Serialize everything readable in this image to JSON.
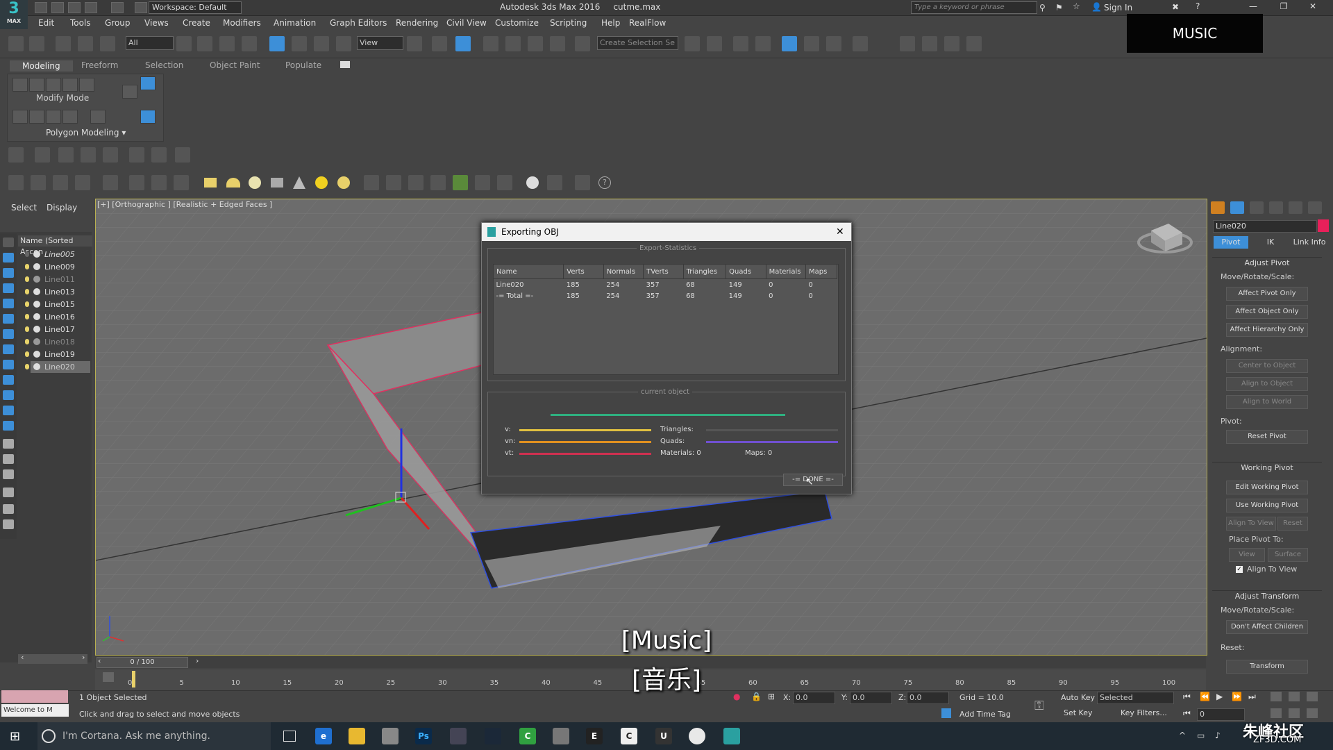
{
  "titlebar": {
    "logo_text": "3",
    "logo_sub": "MAX",
    "workspace": "Workspace: Default",
    "app_title": "Autodesk 3ds Max 2016",
    "file_name": "cutme.max",
    "search_placeholder": "Type a keyword or phrase",
    "signin": "Sign In"
  },
  "menu": [
    "Edit",
    "Tools",
    "Group",
    "Views",
    "Create",
    "Modifiers",
    "Animation",
    "Graph Editors",
    "Rendering",
    "Civil View",
    "Customize",
    "Scripting",
    "Help",
    "RealFlow"
  ],
  "toolbar": {
    "filter_value": "All",
    "refcoord_value": "View",
    "selection_set_placeholder": "Create Selection Se"
  },
  "ribbon": {
    "tabs": [
      "Modeling",
      "Freeform",
      "Selection",
      "Object Paint",
      "Populate"
    ],
    "modify_mode": "Modify Mode",
    "polygon_modeling": "Polygon Modeling"
  },
  "scene_explorer": {
    "tabs": [
      "Select",
      "Display"
    ],
    "header": "Name (Sorted Ascen",
    "items": [
      {
        "name": "Line005",
        "dim": false,
        "italic": true
      },
      {
        "name": "Line009",
        "dim": false,
        "italic": false
      },
      {
        "name": "Line011",
        "dim": true,
        "italic": false
      },
      {
        "name": "Line013",
        "dim": false,
        "italic": false
      },
      {
        "name": "Line015",
        "dim": false,
        "italic": false
      },
      {
        "name": "Line016",
        "dim": false,
        "italic": false
      },
      {
        "name": "Line017",
        "dim": false,
        "italic": false
      },
      {
        "name": "Line018",
        "dim": true,
        "italic": false
      },
      {
        "name": "Line019",
        "dim": false,
        "italic": false
      },
      {
        "name": "Line020",
        "dim": false,
        "italic": false,
        "selected": true
      }
    ]
  },
  "viewport": {
    "label": "[+] [Orthographic ] [Realistic + Edged Faces ]"
  },
  "dialog": {
    "title": "Exporting OBJ",
    "close": "✕",
    "stats_group": "Export-Statistics",
    "columns": [
      "Name",
      "Verts",
      "Normals",
      "TVerts",
      "Triangles",
      "Quads",
      "Materials",
      "Maps"
    ],
    "rows": [
      [
        "Line020",
        "185",
        "254",
        "357",
        "68",
        "149",
        "0",
        "0"
      ],
      [
        "-= Total =-",
        "185",
        "254",
        "357",
        "68",
        "149",
        "0",
        "0"
      ]
    ],
    "current_group": "current object",
    "v_label": "v:",
    "vn_label": "vn:",
    "vt_label": "vt:",
    "triangles_label": "Triangles:",
    "quads_label": "Quads:",
    "materials_label": "Materials: 0",
    "maps_label": "Maps:   0",
    "done": "-= DONE =-"
  },
  "command_panel": {
    "object_name": "Line020",
    "object_color": "#e8205a",
    "tabs": [
      "Pivot",
      "IK",
      "Link Info"
    ],
    "adjust_pivot": "Adjust Pivot",
    "move_rotate_scale": "Move/Rotate/Scale:",
    "affect_pivot_only": "Affect Pivot Only",
    "affect_object_only": "Affect Object Only",
    "affect_hierarchy_only": "Affect Hierarchy Only",
    "alignment": "Alignment:",
    "center_to_object": "Center to Object",
    "align_to_object": "Align to Object",
    "align_to_world": "Align to World",
    "pivot": "Pivot:",
    "reset_pivot": "Reset Pivot",
    "working_pivot": "Working Pivot",
    "edit_working_pivot": "Edit Working Pivot",
    "use_working_pivot": "Use Working Pivot",
    "align_to_view": "Align To View",
    "reset": "Reset",
    "place_pivot_to": "Place Pivot To:",
    "view": "View",
    "surface": "Surface",
    "align_to_view_check": "Align To View",
    "adjust_transform": "Adjust Transform",
    "move_rotate_scale2": "Move/Rotate/Scale:",
    "dont_affect_children": "Don't Affect Children",
    "reset2": "Reset:",
    "transform": "Transform"
  },
  "timeline": {
    "slider": "0 / 100",
    "ticks": [
      "0",
      "5",
      "10",
      "15",
      "20",
      "25",
      "30",
      "35",
      "40",
      "45",
      "50",
      "55",
      "60",
      "65",
      "70",
      "75",
      "80",
      "85",
      "90",
      "95",
      "100"
    ]
  },
  "status": {
    "welcome": "Welcome to M",
    "selected": "1 Object Selected",
    "prompt": "Click and drag to select and move objects",
    "x_label": "X:",
    "x_value": "0.0",
    "y_label": "Y:",
    "y_value": "0.0",
    "z_label": "Z:",
    "z_value": "0.0",
    "grid": "Grid = 10.0",
    "add_time_tag": "Add Time Tag",
    "auto_key": "Auto Key",
    "selected_dropdown": "Selected",
    "set_key": "Set Key",
    "key_filters": "Key Filters...",
    "frame_value": "0"
  },
  "taskbar": {
    "cortana": "I'm Cortana. Ask me anything."
  },
  "overlay": {
    "music_box": "MUSIC",
    "subtitle_en": "[Music]",
    "subtitle_cn": "[音乐]",
    "watermark_cn": "朱峰社区",
    "watermark_url": "ZF3D.COM"
  }
}
